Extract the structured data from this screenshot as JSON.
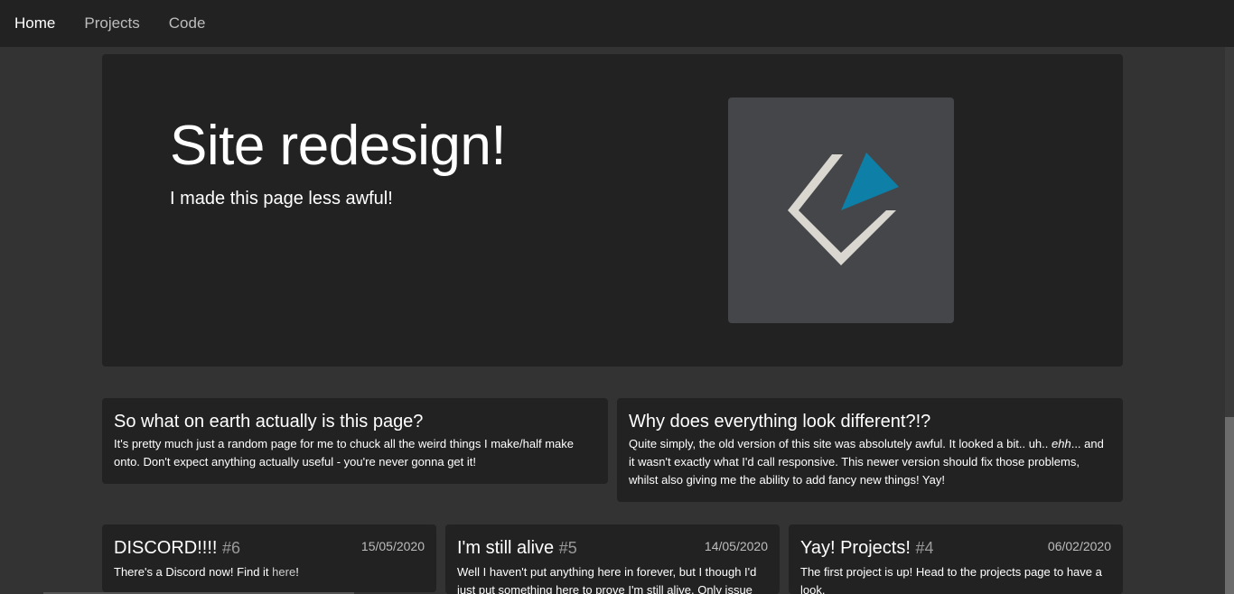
{
  "nav": {
    "items": [
      {
        "label": "Home",
        "active": true
      },
      {
        "label": "Projects",
        "active": false
      },
      {
        "label": "Code",
        "active": false
      }
    ]
  },
  "hero": {
    "title": "Site redesign!",
    "subtitle": "I made this page less awful!",
    "logo_colors": {
      "box": "#45464a",
      "chevron": "#d9d7cf",
      "triangle": "#0e7fa6"
    }
  },
  "info": [
    {
      "title": "So what on earth actually is this page?",
      "body": "It's pretty much just a random page for me to chuck all the weird things I make/half make onto. Don't expect anything actually useful - you're never gonna get it!"
    },
    {
      "title": "Why does everything look different?!?",
      "body_before": "Quite simply, the old version of this site was absolutely awful. It looked a bit.. uh.. ",
      "body_em": "ehh",
      "body_after": "... and it wasn't exactly what I'd call responsive. This newer version should fix those problems, whilst also giving me the ability to add fancy new things! Yay!"
    }
  ],
  "posts": [
    {
      "title": "DISCORD!!!!",
      "number": "#6",
      "date": "15/05/2020",
      "body_before": "There's a Discord now! Find it ",
      "link": "here",
      "body_after": "!"
    },
    {
      "title": "I'm still alive",
      "number": "#5",
      "date": "14/05/2020",
      "body": "Well I haven't put anything here in forever, but I though I'd just put something here to prove I'm still alive. Only issue"
    },
    {
      "title": "Yay! Projects!",
      "number": "#4",
      "date": "06/02/2020",
      "body": "The first project is up! Head to the projects page to have a look."
    }
  ]
}
